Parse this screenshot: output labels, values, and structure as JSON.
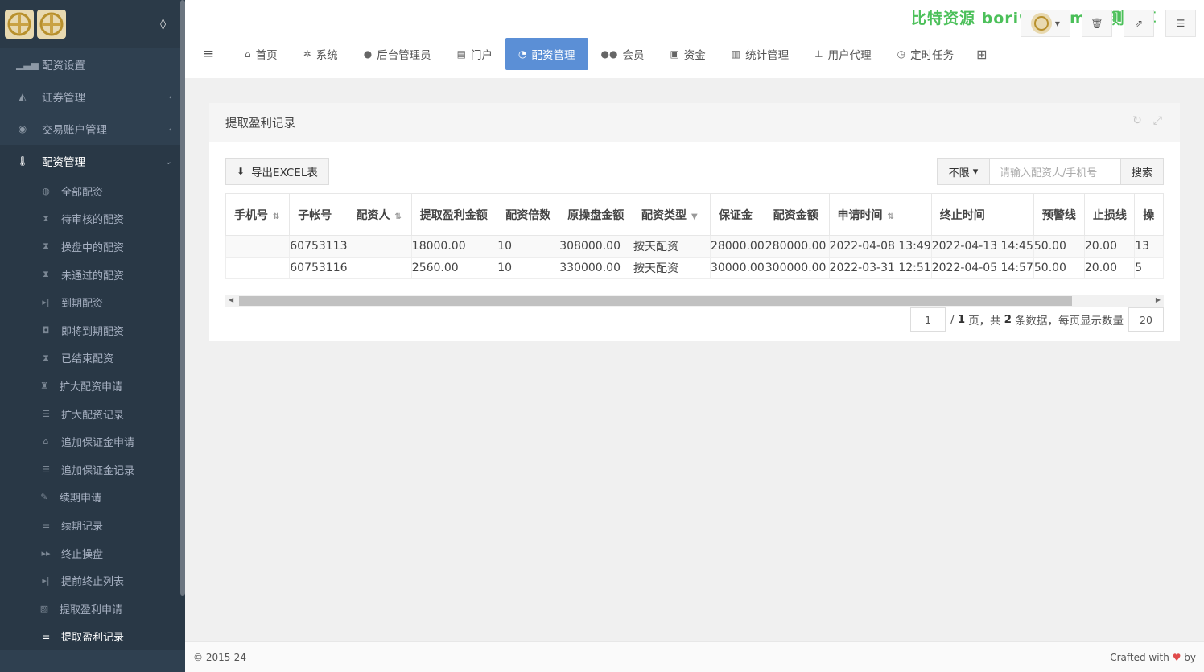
{
  "sidebar": {
    "items": [
      {
        "label": "配资设置",
        "icon": "bar-chart-icon"
      },
      {
        "label": "证券管理",
        "icon": "area-chart-icon",
        "caret": "‹"
      },
      {
        "label": "交易账户管理",
        "icon": "user-circle-icon",
        "caret": "‹"
      },
      {
        "label": "配资管理",
        "icon": "thermometer-icon",
        "caret": "⌄"
      }
    ],
    "sub_items": [
      {
        "label": "全部配资",
        "icon": "globe-icon"
      },
      {
        "label": "待审核的配资",
        "icon": "hourglass-icon"
      },
      {
        "label": "操盘中的配资",
        "icon": "hourglass-icon"
      },
      {
        "label": "未通过的配资",
        "icon": "hourglass-icon"
      },
      {
        "label": "到期配资",
        "icon": "step-forward-icon"
      },
      {
        "label": "即将到期配资",
        "icon": "camera-icon"
      },
      {
        "label": "已结束配资",
        "icon": "hourglass-icon"
      },
      {
        "label": "扩大配资申请",
        "icon": "stamp-icon"
      },
      {
        "label": "扩大配资记录",
        "icon": "list-icon"
      },
      {
        "label": "追加保证金申请",
        "icon": "bank-icon"
      },
      {
        "label": "追加保证金记录",
        "icon": "list-icon"
      },
      {
        "label": "续期申请",
        "icon": "file-edit-icon"
      },
      {
        "label": "续期记录",
        "icon": "list-icon"
      },
      {
        "label": "终止操盘",
        "icon": "fast-forward-icon"
      },
      {
        "label": "提前终止列表",
        "icon": "step-forward-icon"
      },
      {
        "label": "提取盈利申请",
        "icon": "save-icon"
      },
      {
        "label": "提取盈利记录",
        "icon": "list-icon"
      }
    ]
  },
  "topbar": {
    "watermark": "比特资源 bori99.com 实测分享",
    "tabs": [
      {
        "label": "首页",
        "icon": "home-icon",
        "glyph": "⌂"
      },
      {
        "label": "系统",
        "icon": "gear-icon",
        "glyph": "✲"
      },
      {
        "label": "后台管理员",
        "icon": "user-icon",
        "glyph": "●"
      },
      {
        "label": "门户",
        "icon": "newspaper-icon",
        "glyph": "▤"
      },
      {
        "label": "配资管理",
        "icon": "pie-chart-icon",
        "glyph": "◔"
      },
      {
        "label": "会员",
        "icon": "users-icon",
        "glyph": "●●"
      },
      {
        "label": "资金",
        "icon": "money-icon",
        "glyph": "▣"
      },
      {
        "label": "统计管理",
        "icon": "bar-chart-icon",
        "glyph": "▥"
      },
      {
        "label": "用户代理",
        "icon": "sitemap-icon",
        "glyph": "⊥"
      },
      {
        "label": "定时任务",
        "icon": "clock-icon",
        "glyph": "◷"
      }
    ],
    "active_tab": "配资管理"
  },
  "panel": {
    "title": "提取盈利记录",
    "export_label": "导出EXCEL表",
    "filter_select": "不限",
    "search_placeholder": "请输入配资人/手机号",
    "search_button": "搜索"
  },
  "table": {
    "columns": [
      "手机号",
      "子帐号",
      "配资人",
      "提取盈利金额",
      "配资倍数",
      "原操盘金额",
      "配资类型",
      "保证金",
      "配资金额",
      "申请时间",
      "终止时间",
      "预警线",
      "止损线",
      "操"
    ],
    "rows": [
      [
        "",
        "60753113",
        "",
        "18000.00",
        "10",
        "308000.00",
        "按天配资",
        "28000.00",
        "280000.00",
        "2022-04-08 13:49",
        "2022-04-13 14:45",
        "50.00",
        "20.00",
        "13"
      ],
      [
        "",
        "60753116",
        "",
        "2560.00",
        "10",
        "330000.00",
        "按天配资",
        "30000.00",
        "300000.00",
        "2022-03-31 12:51",
        "2022-04-05 14:57",
        "50.00",
        "20.00",
        "5"
      ]
    ]
  },
  "pager": {
    "current_page": "1",
    "text_pre": "/",
    "total_pages": "1",
    "text_mid": "页，共",
    "total_count": "2",
    "text_post": "条数据，每页显示数量",
    "page_size": "20"
  },
  "footer": {
    "copyright": "© 2015-24",
    "crafted": "Crafted with",
    "by": "by"
  }
}
